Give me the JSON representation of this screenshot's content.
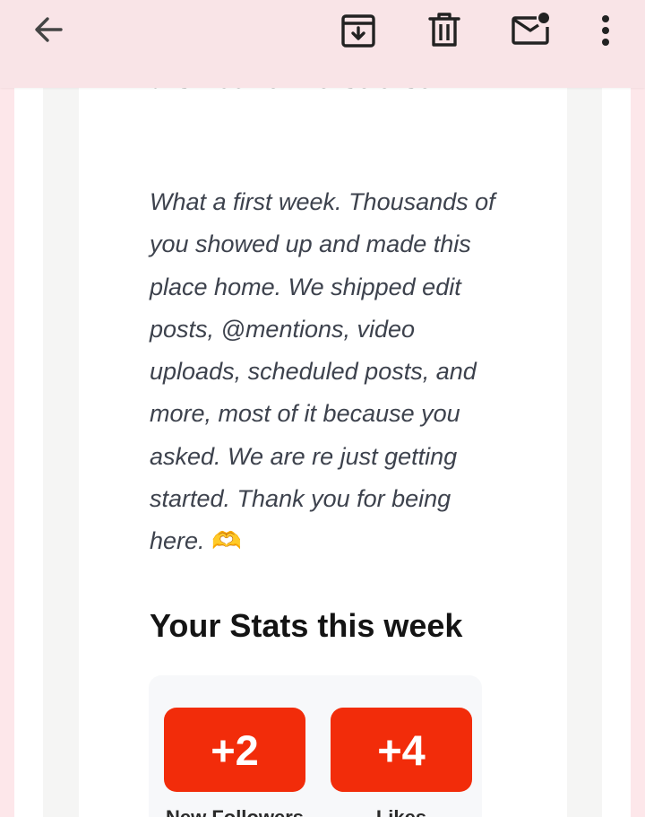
{
  "email": {
    "partial_heading": "this week on Loksolokso.",
    "intro": "What a first week. Thousands of you showed up and made this place home. We shipped edit posts, @mentions, video uploads, scheduled posts, and more, most of it because you asked. We are re just getting started. Thank you for being here.",
    "intro_emoji": "🫶",
    "stats_heading": "Your Stats this week",
    "stats": [
      {
        "value": "+2",
        "label": "New Followers"
      },
      {
        "value": "+4",
        "label": "Likes"
      }
    ]
  },
  "toolbar": {
    "icons": [
      "back-arrow-icon",
      "archive-icon",
      "delete-icon",
      "mark-unread-icon",
      "more-options-icon"
    ]
  },
  "colors": {
    "accent": "#f22c0a",
    "toolbar_bg": "#f9e4e7",
    "page_bg": "#fde7ea"
  }
}
